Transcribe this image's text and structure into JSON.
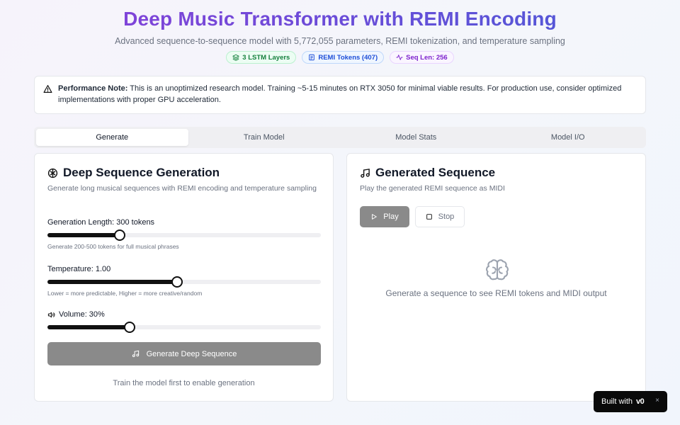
{
  "header": {
    "title": "Deep Music Transformer with REMI Encoding",
    "subtitle": "Advanced sequence-to-sequence model with 5,772,055 parameters, REMI tokenization, and temperature sampling",
    "badges": [
      {
        "label": "3 LSTM Layers",
        "icon": "layers-icon",
        "color": "#15803d"
      },
      {
        "label": "REMI Tokens (407)",
        "icon": "file-icon",
        "color": "#1d4ed8"
      },
      {
        "label": "Seq Len: 256",
        "icon": "activity-icon",
        "color": "#7e22ce"
      }
    ]
  },
  "note": {
    "bold": "Performance Note:",
    "text": " This is an unoptimized research model. Training ~5-15 minutes on RTX 3050 for minimal viable results. For production use, consider optimized implementations with proper GPU acceleration."
  },
  "tabs": [
    {
      "label": "Generate",
      "active": true
    },
    {
      "label": "Train Model",
      "active": false
    },
    {
      "label": "Model Stats",
      "active": false
    },
    {
      "label": "Model I/O",
      "active": false
    }
  ],
  "generation": {
    "title": "Deep Sequence Generation",
    "description": "Generate long musical sequences with REMI encoding and temperature sampling",
    "length": {
      "label": "Generation Length: 300 tokens",
      "value": 300,
      "min": 50,
      "max": 1000,
      "hint": "Generate 200-500 tokens for full musical phrases"
    },
    "temperature": {
      "label": "Temperature: 1.00",
      "value": 1.0,
      "min": 0.1,
      "max": 2.0,
      "hint": "Lower = more predictable, Higher = more creative/random"
    },
    "volume": {
      "label": "Volume: 30%",
      "value": 30,
      "min": 0,
      "max": 100
    },
    "button": "Generate Deep Sequence",
    "message": "Train the model first to enable generation"
  },
  "sequence": {
    "title": "Generated Sequence",
    "description": "Play the generated REMI sequence as MIDI",
    "play": "Play",
    "stop": "Stop",
    "empty": "Generate a sequence to see REMI tokens and MIDI output"
  },
  "built": {
    "prefix": "Built with",
    "brand": "v0",
    "close": "×"
  }
}
